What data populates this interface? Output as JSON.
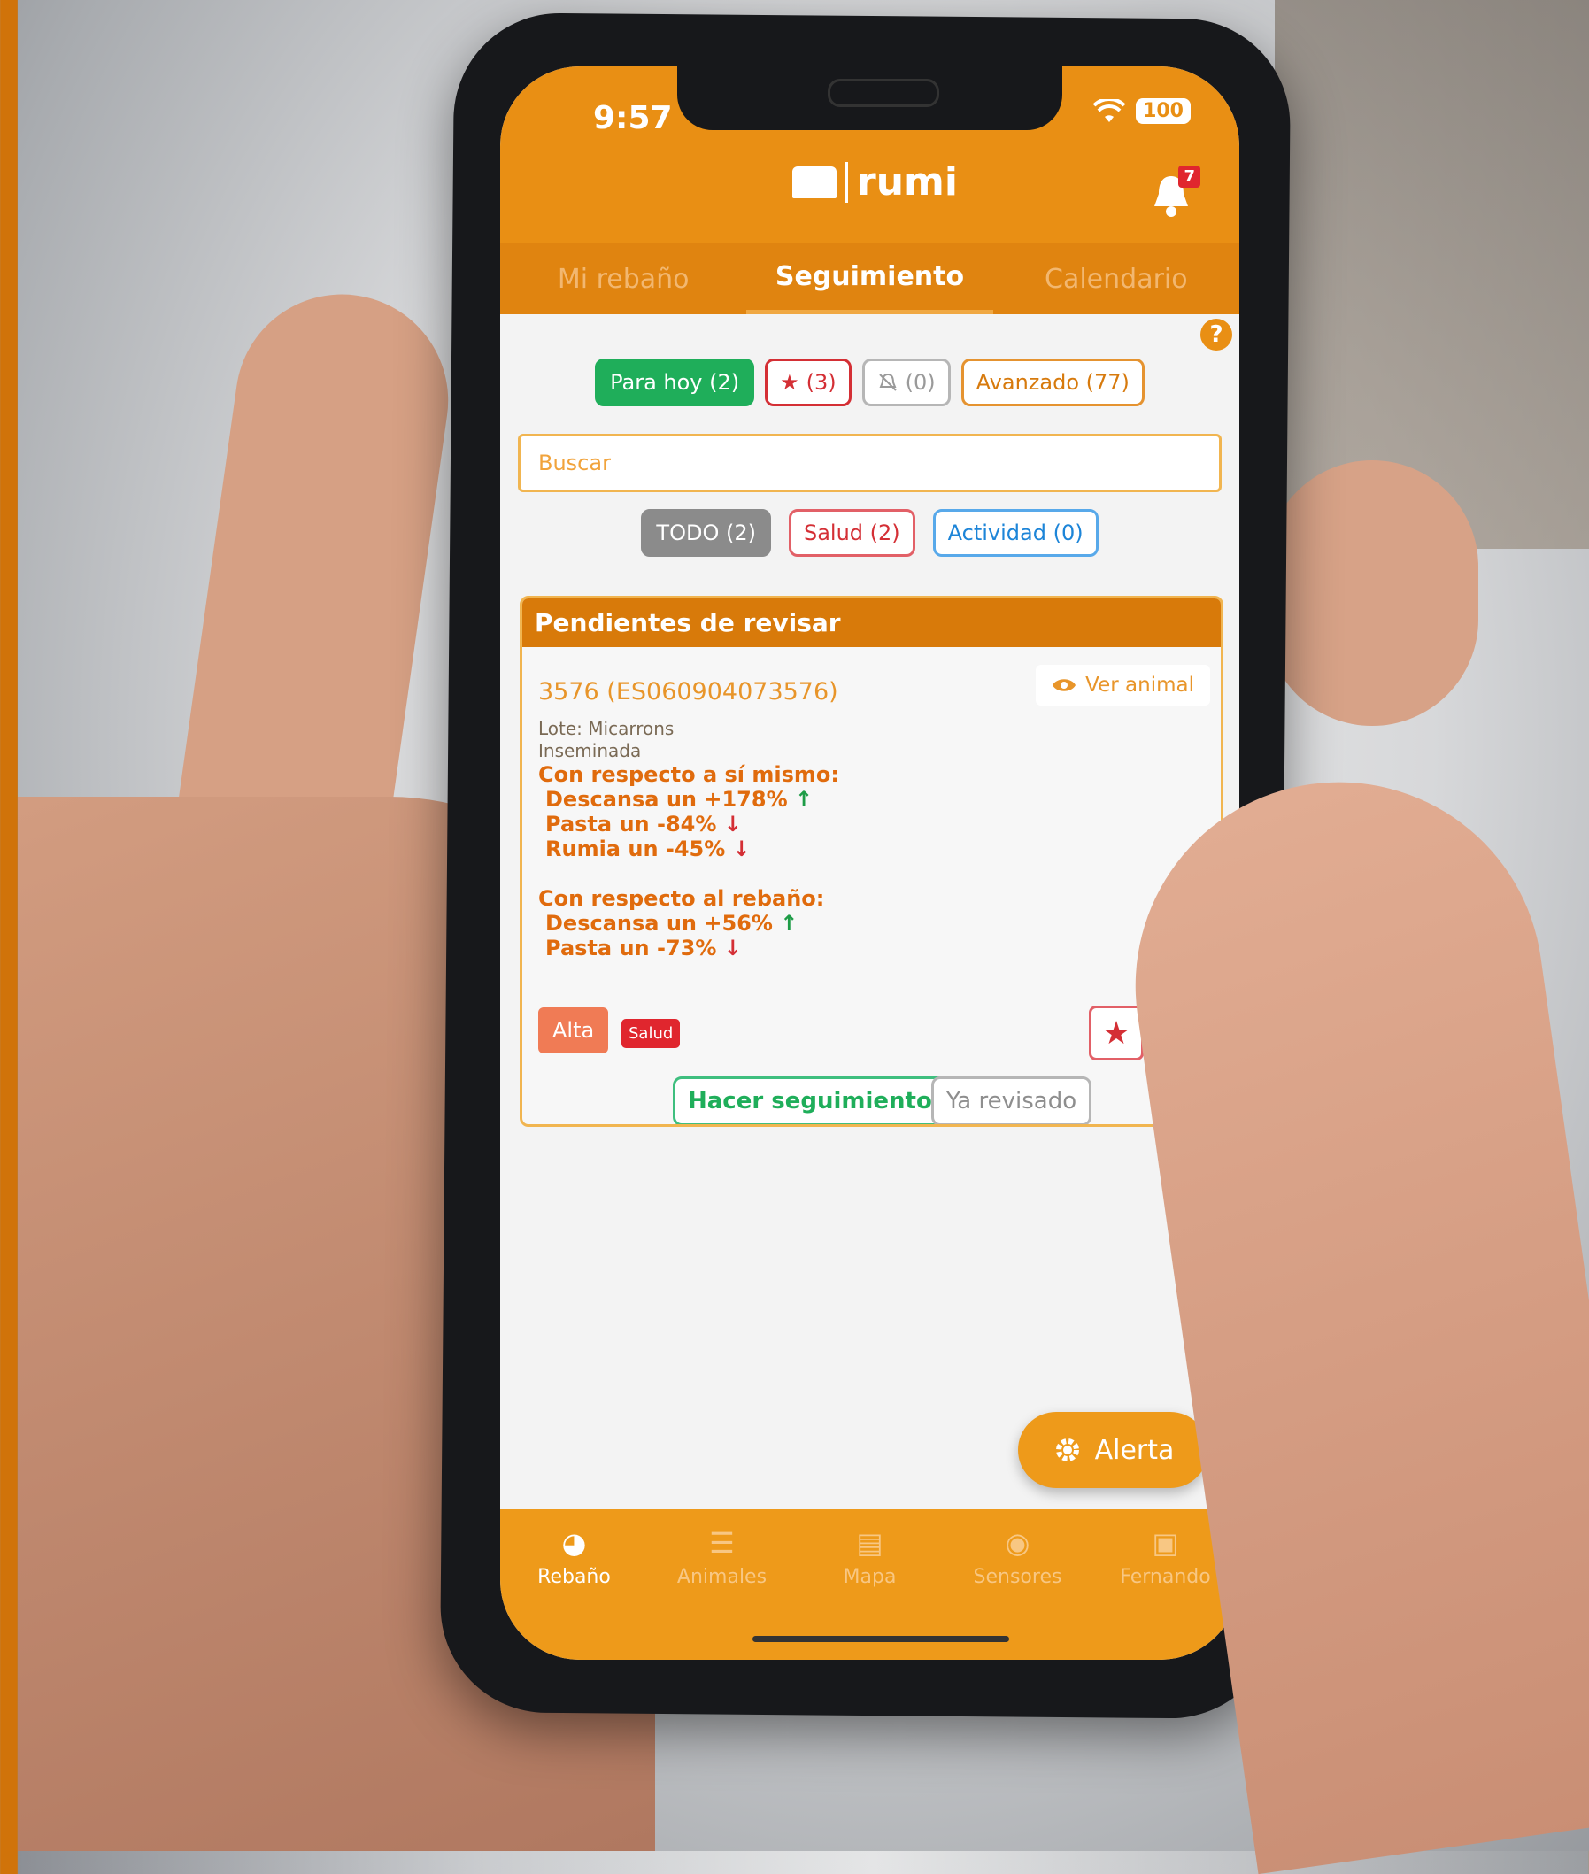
{
  "status_bar": {
    "time": "9:57",
    "battery": "100"
  },
  "app": {
    "logo_text": "rumi",
    "notification_count": "7"
  },
  "tabs": [
    {
      "label": "Mi rebaño"
    },
    {
      "label": "Seguimiento"
    },
    {
      "label": "Calendario"
    }
  ],
  "filters": {
    "para_hoy": "Para hoy (2)",
    "starred": "(3)",
    "muted": "(0)",
    "avanzado": "Avanzado (77)"
  },
  "search": {
    "placeholder": "Buscar"
  },
  "types": {
    "todo": "TODO (2)",
    "salud": "Salud (2)",
    "actividad": "Actividad (0)"
  },
  "card": {
    "header": "Pendientes de revisar",
    "animal_id": "3576 (ES060904073576)",
    "ver_animal": "Ver animal",
    "lote": "Lote: Micarrons",
    "estado": "Inseminada",
    "self_heading": "Con respecto a sí mismo:",
    "self_stats": [
      {
        "text": "Descansa un +178%",
        "arrow": "↑"
      },
      {
        "text": "Pasta un -84%",
        "arrow": "↓"
      },
      {
        "text": "Rumia un -45%",
        "arrow": "↓"
      }
    ],
    "herd_heading": "Con respecto al rebaño:",
    "herd_stats": [
      {
        "text": "Descansa un +56%",
        "arrow": "↑"
      },
      {
        "text": "Pasta un -73%",
        "arrow": "↓"
      }
    ],
    "tag_alta": "Alta",
    "tag_salud": "Salud",
    "hacer_seguimiento": "Hacer seguimiento",
    "ya_revisado": "Ya revisado"
  },
  "alerta_button": "Alerta",
  "bottom_nav": [
    {
      "label": "Rebaño"
    },
    {
      "label": "Animales"
    },
    {
      "label": "Mapa"
    },
    {
      "label": "Sensores"
    },
    {
      "label": "Fernando"
    }
  ],
  "colors": {
    "brand_orange": "#e98f14",
    "dark_orange": "#d87a0a",
    "green": "#1fae5a",
    "red": "#d42f35",
    "blue": "#1d85d8"
  }
}
